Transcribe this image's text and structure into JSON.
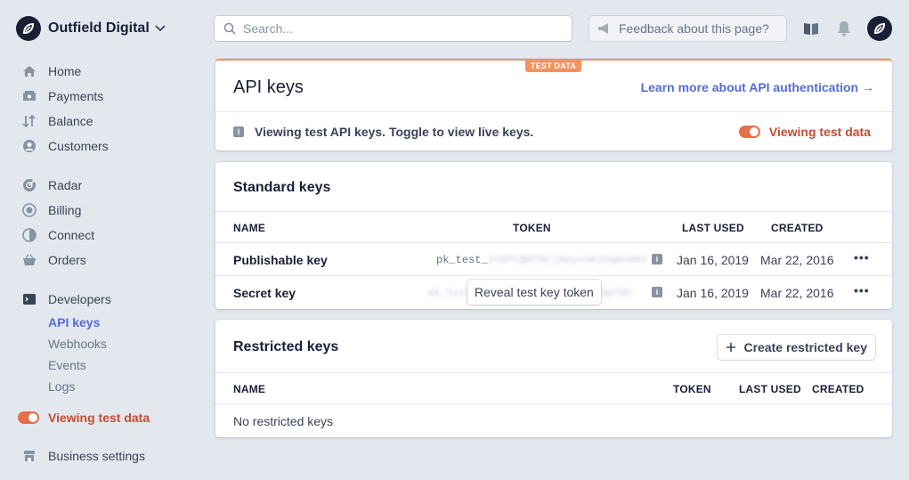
{
  "account": {
    "name": "Outfield Digital"
  },
  "nav": {
    "items": [
      {
        "label": "Home",
        "icon": "home-icon"
      },
      {
        "label": "Payments",
        "icon": "payments-icon"
      },
      {
        "label": "Balance",
        "icon": "balance-icon"
      },
      {
        "label": "Customers",
        "icon": "customers-icon"
      },
      {
        "label": "Radar",
        "icon": "radar-icon"
      },
      {
        "label": "Billing",
        "icon": "billing-icon"
      },
      {
        "label": "Connect",
        "icon": "connect-icon"
      },
      {
        "label": "Orders",
        "icon": "orders-icon"
      },
      {
        "label": "Developers",
        "icon": "terminal-icon"
      }
    ],
    "developers_sub": [
      "API keys",
      "Webhooks",
      "Events",
      "Logs"
    ],
    "active_sub": "API keys",
    "toggle_label": "Viewing test data",
    "business_settings": "Business settings"
  },
  "topbar": {
    "search_placeholder": "Search...",
    "feedback": "Feedback about this page?"
  },
  "colors": {
    "accent": "#556cd6",
    "test": "#e56f4a",
    "test_text": "#c44c34",
    "test_banner": "#f5925e"
  },
  "header_card": {
    "badge": "TEST DATA",
    "title": "API keys",
    "learn_link": "Learn more about API authentication →",
    "info": "Viewing test API keys. Toggle to view live keys.",
    "toggle_label": "Viewing test data"
  },
  "standard_keys": {
    "title": "Standard keys",
    "columns": {
      "name": "NAME",
      "token": "TOKEN",
      "last_used": "LAST USED",
      "created": "CREATED"
    },
    "rows": [
      {
        "name": "Publishable key",
        "token_prefix": "pk_test_",
        "token_masked": "2n5Pt@8TNcj9eyvnKJGqbn002",
        "last_used": "Jan 16, 2019",
        "created": "Mar 22, 2016",
        "more": "•••"
      },
      {
        "name": "Secret key",
        "token_prefix": "sk_test_",
        "token_masked": "4eC39HqLyjWDarjtT1zdp7dc",
        "reveal_label": "Reveal test key token",
        "last_used": "Jan 16, 2019",
        "created": "Mar 22, 2016",
        "more": "•••"
      }
    ]
  },
  "restricted_keys": {
    "title": "Restricted keys",
    "create_label": "Create restricted key",
    "columns": {
      "name": "NAME",
      "token": "TOKEN",
      "last_used": "LAST USED",
      "created": "CREATED"
    },
    "empty": "No restricted keys"
  }
}
